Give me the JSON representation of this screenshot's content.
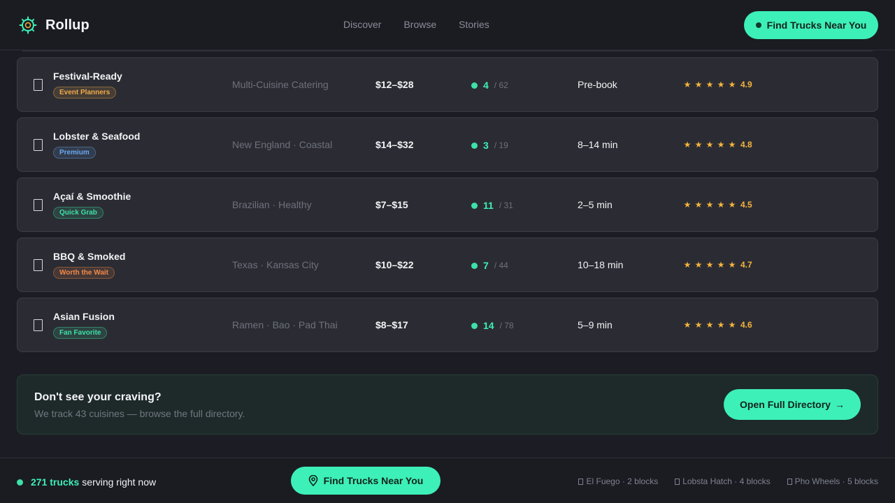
{
  "header": {
    "brand": "Rollup",
    "nav": [
      "Discover",
      "Browse",
      "Stories"
    ],
    "cta": "Find Trucks Near You"
  },
  "colors": {
    "accent": "#3df0b7",
    "star": "#f3b33d",
    "background": "#1c1d24"
  },
  "rows": [
    {
      "name": "Festival-Ready",
      "tag": "Event Planners",
      "tag_color": "#f0a94a",
      "cuisine": "Multi-Cuisine Catering",
      "price": "$12–$28",
      "available": "4",
      "total": "/ 62",
      "wait": "Pre-book",
      "rating": "4.9"
    },
    {
      "name": "Lobster & Seafood",
      "tag": "Premium",
      "tag_color": "#6aa7f0",
      "cuisine": "New England · Coastal",
      "price": "$14–$32",
      "available": "3",
      "total": "/ 19",
      "wait": "8–14 min",
      "rating": "4.8"
    },
    {
      "name": "Açaí & Smoothie",
      "tag": "Quick Grab",
      "tag_color": "#3ee0a8",
      "cuisine": "Brazilian · Healthy",
      "price": "$7–$15",
      "available": "11",
      "total": "/ 31",
      "wait": "2–5 min",
      "rating": "4.5"
    },
    {
      "name": "BBQ & Smoked",
      "tag": "Worth the Wait",
      "tag_color": "#f08a4a",
      "cuisine": "Texas · Kansas City",
      "price": "$10–$22",
      "available": "7",
      "total": "/ 44",
      "wait": "10–18 min",
      "rating": "4.7"
    },
    {
      "name": "Asian Fusion",
      "tag": "Fan Favorite",
      "tag_color": "#3ee0a8",
      "cuisine": "Ramen · Bao · Pad Thai",
      "price": "$8–$17",
      "available": "14",
      "total": "/ 78",
      "wait": "5–9 min",
      "rating": "4.6"
    }
  ],
  "banner": {
    "title": "Don't see your craving?",
    "subtitle": "We track 43 cuisines — browse the full directory.",
    "button": "Open Full Directory",
    "button_arrow": "→"
  },
  "footer": {
    "count": "271 trucks",
    "count_suffix": "serving right now",
    "cta": "Find Trucks Near You",
    "nearby": [
      "El Fuego · 2 blocks",
      "Lobsta Hatch · 4 blocks",
      "Pho Wheels · 5 blocks"
    ]
  }
}
